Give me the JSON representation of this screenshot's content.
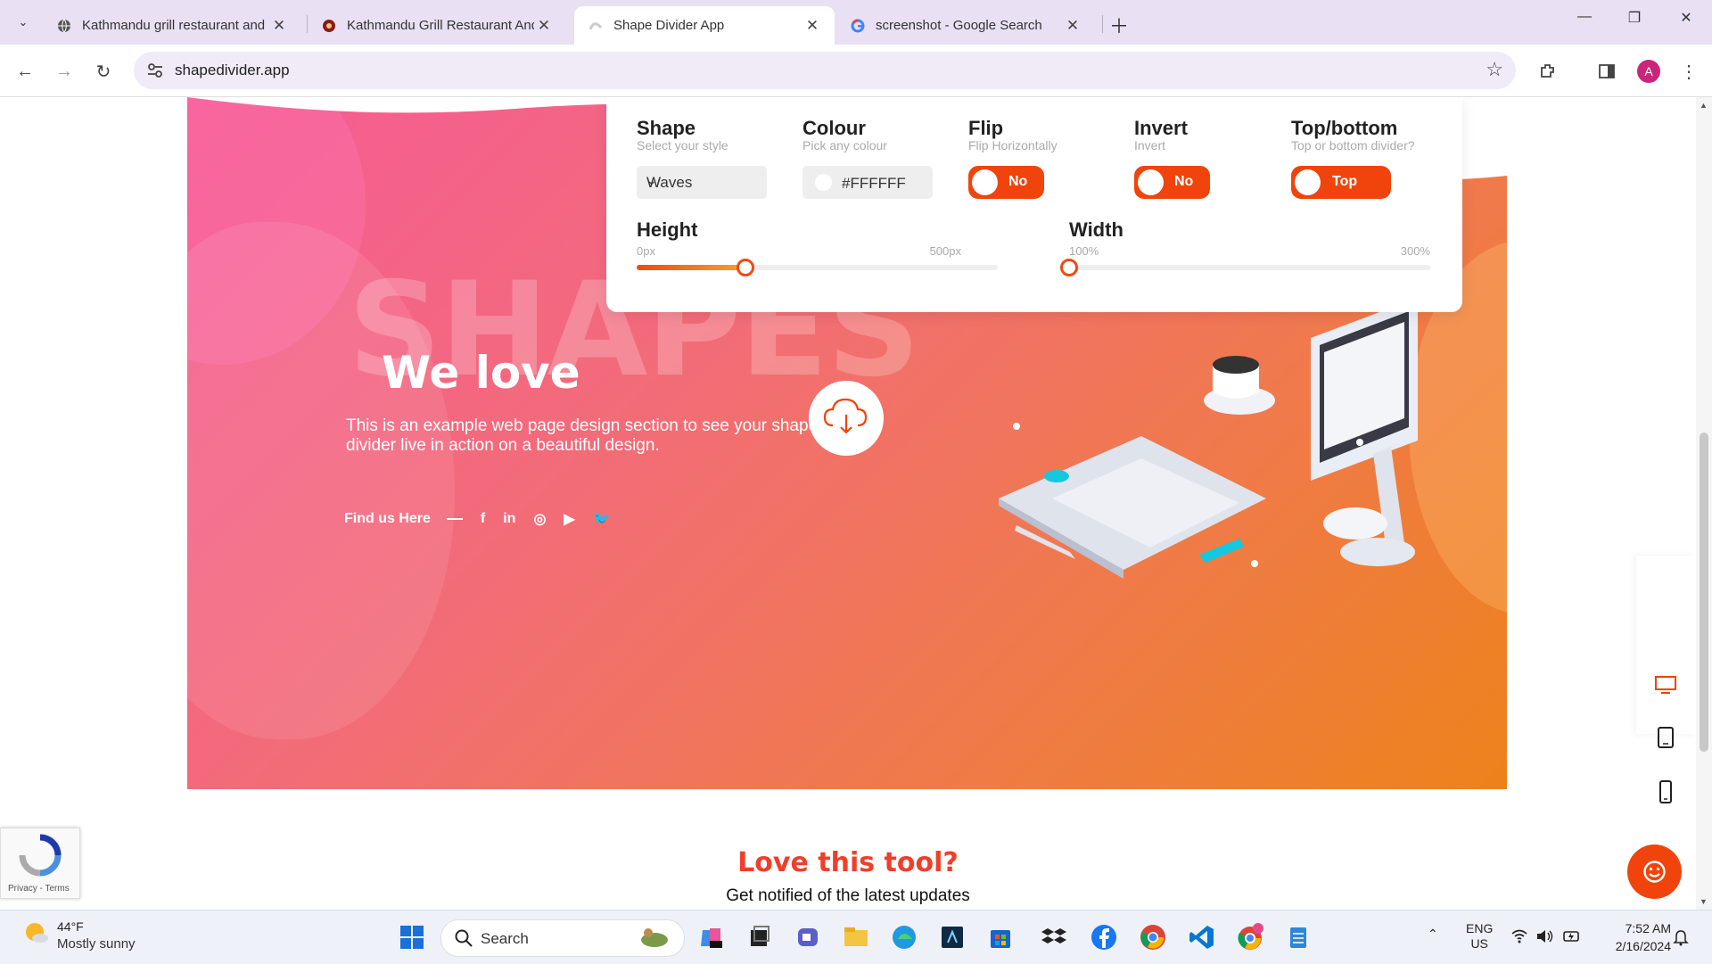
{
  "browser": {
    "tabs": [
      {
        "title": "Kathmandu grill restaurant and",
        "active": false
      },
      {
        "title": "Kathmandu Grill Restaurant And",
        "active": false
      },
      {
        "title": "Shape Divider App",
        "active": true
      },
      {
        "title": "screenshot - Google Search",
        "active": false
      }
    ],
    "url": "shapedivider.app",
    "profile_initial": "A"
  },
  "controls": {
    "shape": {
      "title": "Shape",
      "subtitle": "Select your style",
      "value": "Waves"
    },
    "colour": {
      "title": "Colour",
      "subtitle": "Pick any colour",
      "value": "#FFFFFF"
    },
    "flip": {
      "title": "Flip",
      "subtitle": "Flip Horizontally",
      "toggle": "No"
    },
    "invert": {
      "title": "Invert",
      "subtitle": "Invert",
      "toggle": "No"
    },
    "topbottom": {
      "title": "Top/bottom",
      "subtitle": "Top or bottom divider?",
      "toggle": "Top"
    },
    "height": {
      "title": "Height",
      "min": "0px",
      "max": "500px",
      "value_fraction": 0.3
    },
    "width": {
      "title": "Width",
      "min": "100%",
      "max": "300%",
      "value_fraction": 0.0
    }
  },
  "hero": {
    "bg_word": "SHAPES",
    "heading": "We love",
    "description": "This is an example web page design section to see your shape divider live in action on a beautiful design.",
    "find_us": "Find us Here",
    "social_icons": [
      "facebook-icon",
      "linkedin-icon",
      "instagram-icon",
      "youtube-icon",
      "twitter-icon"
    ],
    "social_glyphs": [
      "f",
      "in",
      "◎",
      "▶",
      "🐦"
    ]
  },
  "footer_section": {
    "title": "Love this tool?",
    "subtitle": "Get notified of the latest updates"
  },
  "recaptcha": {
    "links": "Privacy - Terms"
  },
  "taskbar": {
    "weather_temp": "44°F",
    "weather_desc": "Mostly sunny",
    "search_label": "Search",
    "language_line1": "ENG",
    "language_line2": "US",
    "time": "7:52 AM",
    "date": "2/16/2024"
  },
  "colors": {
    "accent": "#f0440c",
    "love_title": "#ef3f2b"
  }
}
